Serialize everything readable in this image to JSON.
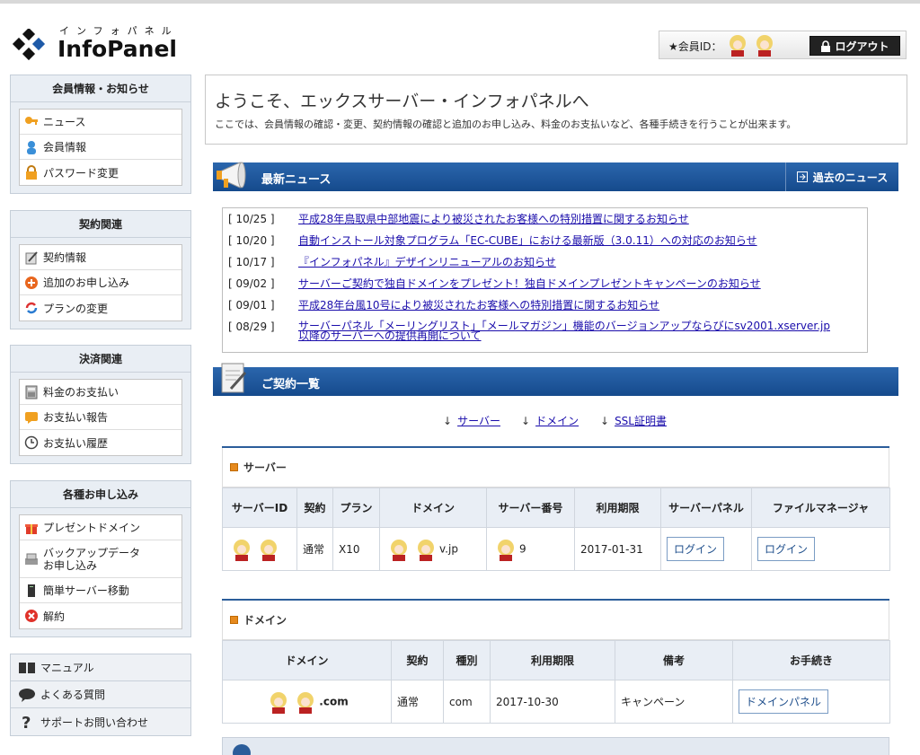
{
  "header": {
    "logo_kana": "インフォパネル",
    "logo_name": "InfoPanel",
    "member_id_label": "★会員ID：",
    "logout_label": "ログアウト"
  },
  "sidebar": {
    "groups": [
      {
        "title": "会員情報・お知らせ",
        "items": [
          "ニュース",
          "会員情報",
          "パスワード変更"
        ]
      },
      {
        "title": "契約関連",
        "items": [
          "契約情報",
          "追加のお申し込み",
          "プランの変更"
        ]
      },
      {
        "title": "決済関連",
        "items": [
          "料金のお支払い",
          "お支払い報告",
          "お支払い履歴"
        ]
      },
      {
        "title": "各種お申し込み",
        "items": [
          "プレゼントドメイン",
          "バックアップデータ",
          "お申し込み",
          "簡単サーバー移動",
          "解約"
        ]
      }
    ],
    "bottom": [
      "マニュアル",
      "よくある質問",
      "サポートお問い合わせ"
    ]
  },
  "welcome": {
    "title": "ようこそ、エックスサーバー・インフォパネルへ",
    "desc": "ここでは、会員情報の確認・変更、契約情報の確認と追加のお申し込み、料金のお支払いなど、各種手続きを行うことが出来ます。"
  },
  "news": {
    "title": "最新ニュース",
    "past_label": "過去のニュース",
    "items": [
      {
        "date": "[ 10/25 ]",
        "text": "平成28年鳥取県中部地震により被災されたお客様への特別措置に関するお知らせ"
      },
      {
        "date": "[ 10/20 ]",
        "text": "自動インストール対象プログラム「EC-CUBE」における最新版（3.0.11）への対応のお知らせ"
      },
      {
        "date": "[ 10/17 ]",
        "text": "『インフォパネル』デザインリニューアルのお知らせ"
      },
      {
        "date": "[ 09/02 ]",
        "text": "サーバーご契約で独自ドメインをプレゼント！独自ドメインプレゼントキャンペーンのお知らせ"
      },
      {
        "date": "[ 09/01 ]",
        "text": "平成28年台風10号により被災されたお客様への特別措置に関するお知らせ"
      },
      {
        "date": "[ 08/29 ]",
        "text": "サーバーパネル「メーリングリスト」「メールマガジン」機能のバージョンアップならびにsv2001.xserver.jp",
        "text2": "以降のサーバーへの提供再開について"
      }
    ]
  },
  "contracts": {
    "title": "ご契約一覧",
    "jump": [
      "サーバー",
      "ドメイン",
      "SSL証明書"
    ],
    "server": {
      "heading": "サーバー",
      "columns": [
        "サーバーID",
        "契約",
        "プラン",
        "ドメイン",
        "サーバー番号",
        "利用期限",
        "サーバーパネル",
        "ファイルマネージャ"
      ],
      "row": {
        "contract": "通常",
        "plan": "X10",
        "domain_suffix": "v.jp",
        "server_no_suffix": "9",
        "expiry": "2017-01-31",
        "panel_btn": "ログイン",
        "fm_btn": "ログイン"
      }
    },
    "domain": {
      "heading": "ドメイン",
      "columns": [
        "ドメイン",
        "契約",
        "種別",
        "利用期限",
        "備考",
        "お手続き"
      ],
      "row": {
        "domain_suffix": ".com",
        "contract": "通常",
        "type": "com",
        "expiry": "2017-10-30",
        "note": "キャンペーン",
        "btn": "ドメインパネル"
      }
    }
  },
  "colors": {
    "nav_blue": "#1f5596",
    "sidebar_bg": "#e9eef4",
    "accent_orange": "#e68a1e"
  }
}
